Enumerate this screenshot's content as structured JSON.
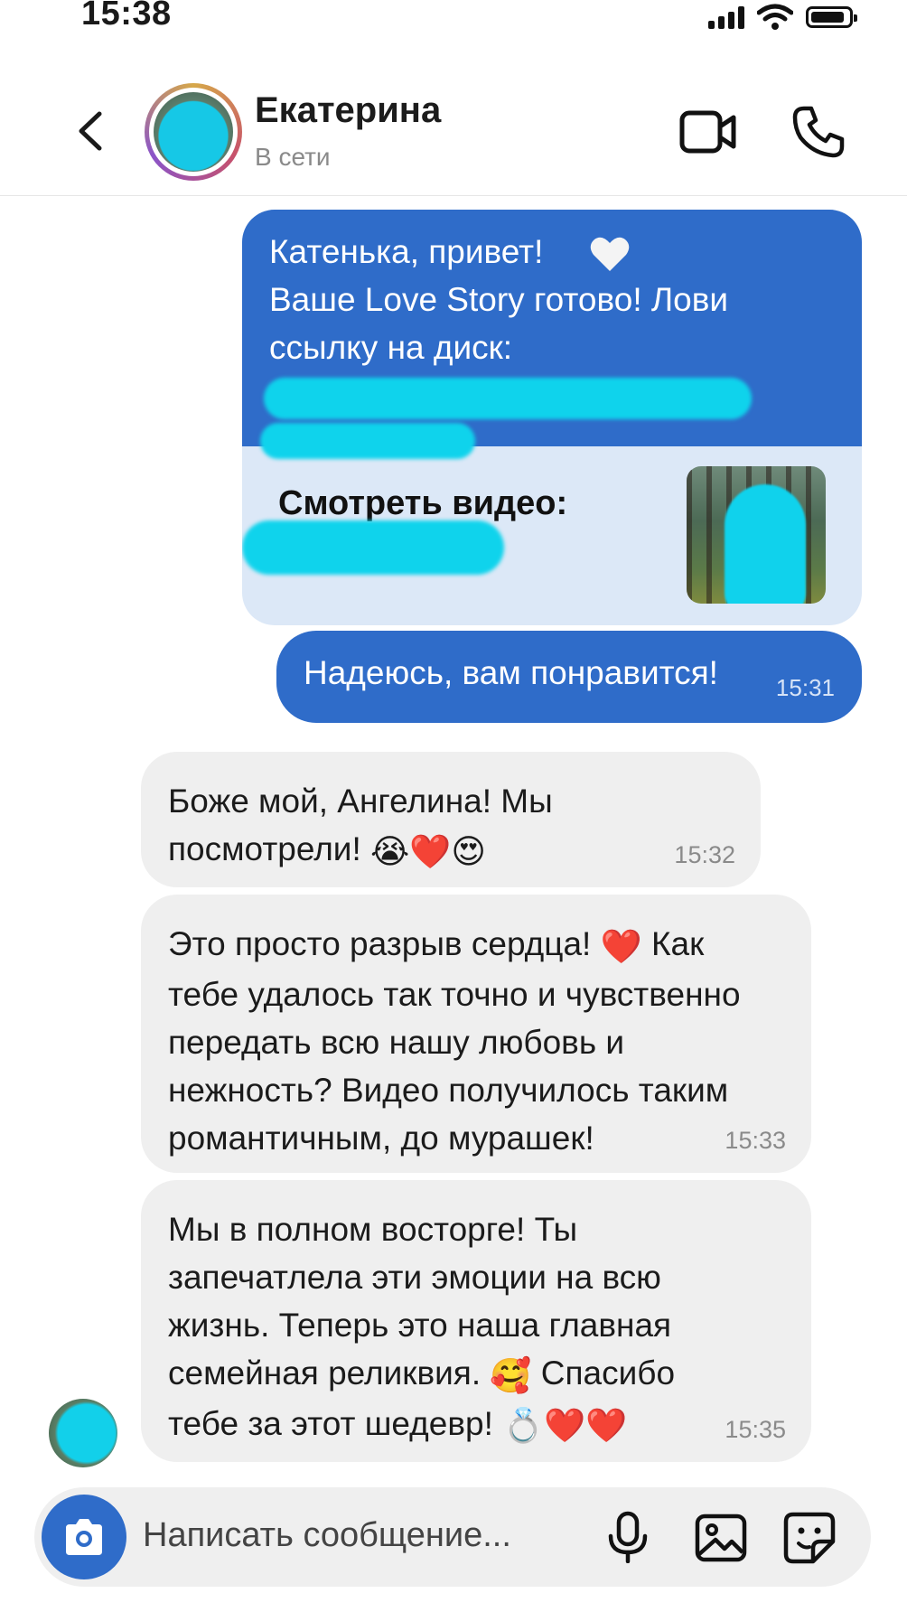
{
  "status_bar": {
    "time": "15:38",
    "battery_level": 0.9
  },
  "header": {
    "contact_name": "Екатерина",
    "contact_status": "В сети"
  },
  "messages": {
    "outgoing_card": {
      "text": "Катенька, привет!\nВаше Love Story готово! Лови ссылку на диск:",
      "link_preview_label": "Смотреть видео:"
    },
    "outgoing_2": {
      "text": "Надеюсь, вам понравится!",
      "time": "15:31"
    },
    "incoming_1": {
      "text": "Боже мой, Ангелина! Мы\nпосмотрели!",
      "emojis": "😭❤️😍",
      "time": "15:32"
    },
    "incoming_2": {
      "text_before": "Это просто разрыв сердца! ",
      "emoji": "❤️",
      "text_after": " Как\nтебе удалось так точно и чувственно\nпередать всю нашу любовь и\nнежность? Видео получилось таким\nромантичным, до мурашек!",
      "time": "15:33"
    },
    "incoming_3": {
      "text_before": "Мы в полном восторге! Ты\nзапечатлела эти эмоции на всю\nжизнь. Теперь это наша главная\nсемейная реликвия. ",
      "emoji_mid": "🥰",
      "text_after": " Спасибо\nтебе за этот шедевр! ",
      "emojis_end": "💍❤️❤️",
      "time": "15:35"
    }
  },
  "input": {
    "placeholder": "Написать сообщение..."
  },
  "colors": {
    "accent": "#2f6cc9",
    "incoming_bubble": "#efefef",
    "redaction": "#0fd3ec"
  }
}
